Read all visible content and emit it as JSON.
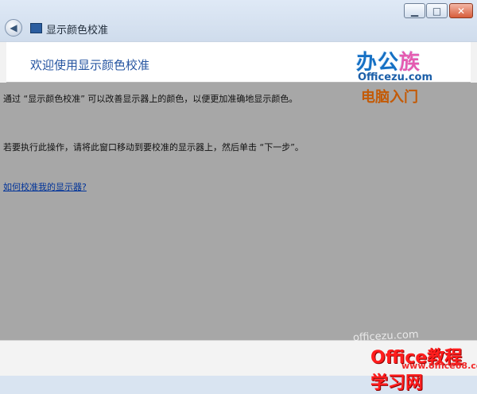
{
  "window": {
    "title": "显示颜色校准"
  },
  "header": {
    "heading": "欢迎使用显示颜色校准"
  },
  "content": {
    "p1": "通过 “显示颜色校准” 可以改善显示器上的颜色，以便更加准确地显示颜色。",
    "p2": "若要执行此操作，请将此窗口移动到要校准的显示器上，然后单击 “下一步”。",
    "link": "如何校准我的显示器?"
  },
  "brand": {
    "main_prefix": "办公",
    "main_suffix": "族",
    "domain": "Officezu.com",
    "sub": "电脑入门"
  },
  "watermark": {
    "site_small": "officezu.com",
    "site_big": "Office教程学习网",
    "site_url": "www.office68.com"
  },
  "colors": {
    "heading": "#2655a1",
    "content_overlay": "#a7a7a7",
    "link": "#003399",
    "brand_blue": "#1570c4",
    "brand_orange": "#c35a06",
    "watermark_red": "#ff1d1d"
  },
  "icons": {
    "back": "back-arrow-icon",
    "app": "monitor-icon",
    "minimize": "minimize-icon",
    "maximize": "maximize-icon",
    "close": "close-icon"
  }
}
